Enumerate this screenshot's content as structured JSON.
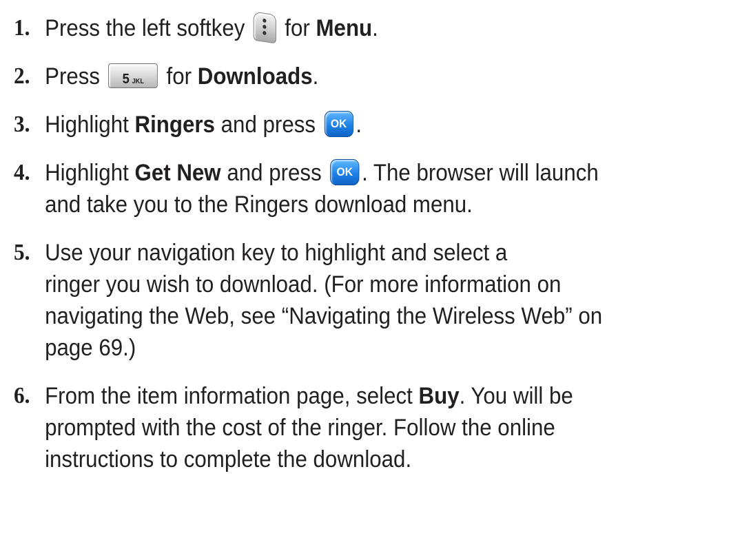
{
  "steps": [
    {
      "number": "1.",
      "before": "Press the left softkey",
      "icon": "left-softkey-icon",
      "after": " for ",
      "bold": "Menu",
      "end": "."
    },
    {
      "number": "2.",
      "before": "Press",
      "icon": "keypad-5-icon",
      "key_digit": "5",
      "key_letters": "JKL",
      "after": " for ",
      "bold": "Downloads",
      "end": "."
    },
    {
      "number": "3.",
      "before": "Highlight ",
      "bold": "Ringers",
      "middle": " and press",
      "icon": "ok-key-icon",
      "key_label": "OK",
      "end": "."
    },
    {
      "number": "4.",
      "before": "Highlight ",
      "bold": "Get New",
      "middle": " and press",
      "icon": "ok-key-icon",
      "key_label": "OK",
      "end": ". The browser will launch",
      "line2": "and take you to the Ringers download menu."
    },
    {
      "number": "5.",
      "line1": "Use your navigation key to highlight and select a",
      "line2": "ringer you wish to download. (For more information on",
      "line3": "navigating the Web, see “Navigating the Wireless Web” on",
      "line4": "page 69.)"
    },
    {
      "number": "6.",
      "before": "From the item information page, select ",
      "bold": "Buy",
      "end": ". You will be",
      "line2": "prompted with the cost of the ringer. Follow the online",
      "line3": "instructions to complete the download."
    }
  ]
}
